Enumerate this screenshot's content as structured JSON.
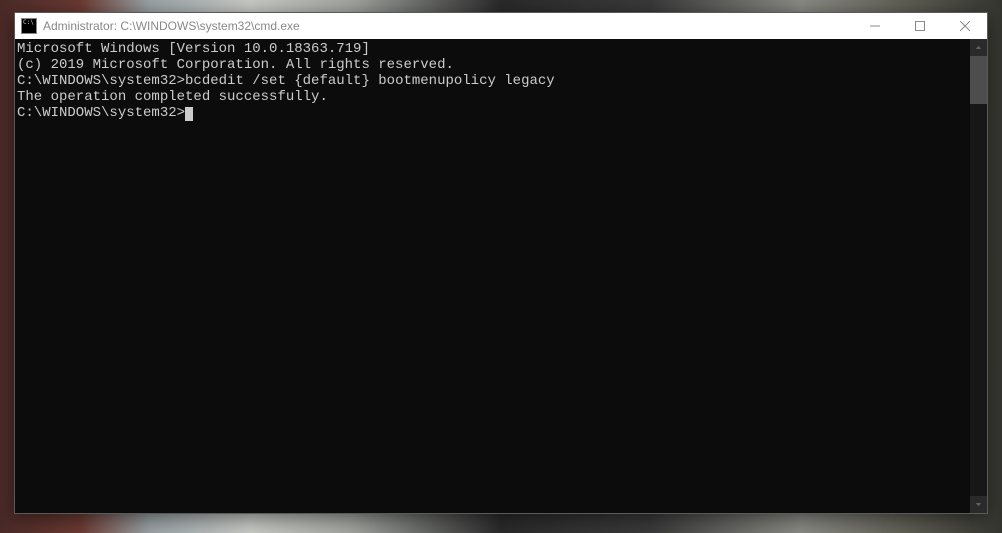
{
  "titlebar": {
    "title": "Administrator: C:\\WINDOWS\\system32\\cmd.exe",
    "minimize_label": "Minimize",
    "maximize_label": "Maximize",
    "close_label": "Close"
  },
  "terminal": {
    "lines": {
      "l1": "Microsoft Windows [Version 10.0.18363.719]",
      "l2": "(c) 2019 Microsoft Corporation. All rights reserved.",
      "l3": "",
      "l4_prompt": "C:\\WINDOWS\\system32>",
      "l4_cmd": "bcdedit /set {default} bootmenupolicy legacy",
      "l5": "The operation completed successfully.",
      "l6": "",
      "l7_prompt": "C:\\WINDOWS\\system32>"
    }
  }
}
